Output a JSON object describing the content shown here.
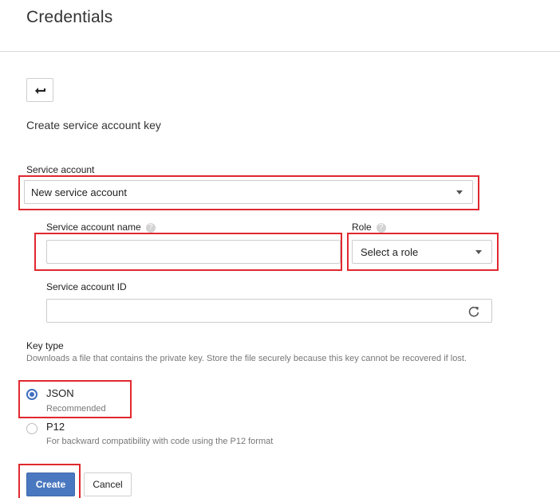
{
  "page": {
    "title": "Credentials"
  },
  "form": {
    "heading": "Create service account key",
    "service_account": {
      "label": "Service account",
      "selected": "New service account"
    },
    "service_account_name": {
      "label": "Service account name",
      "value": ""
    },
    "role": {
      "label": "Role",
      "selected": "Select a role"
    },
    "service_account_id": {
      "label": "Service account ID",
      "value": ""
    },
    "key_type": {
      "label": "Key type",
      "description": "Downloads a file that contains the private key. Store the file securely because this key cannot be recovered if lost.",
      "options": [
        {
          "label": "JSON",
          "sub": "Recommended",
          "selected": true
        },
        {
          "label": "P12",
          "sub": "For backward compatibility with code using the P12 format",
          "selected": false
        }
      ]
    },
    "buttons": {
      "create": "Create",
      "cancel": "Cancel"
    }
  },
  "icons": {
    "back": "arrow-back-icon",
    "help": "help-circle-icon",
    "refresh": "refresh-icon",
    "dropdown": "caret-down-icon"
  },
  "colors": {
    "primary": "#4a78c0",
    "highlight": "#e0282f",
    "radio": "#3f6fbf"
  }
}
